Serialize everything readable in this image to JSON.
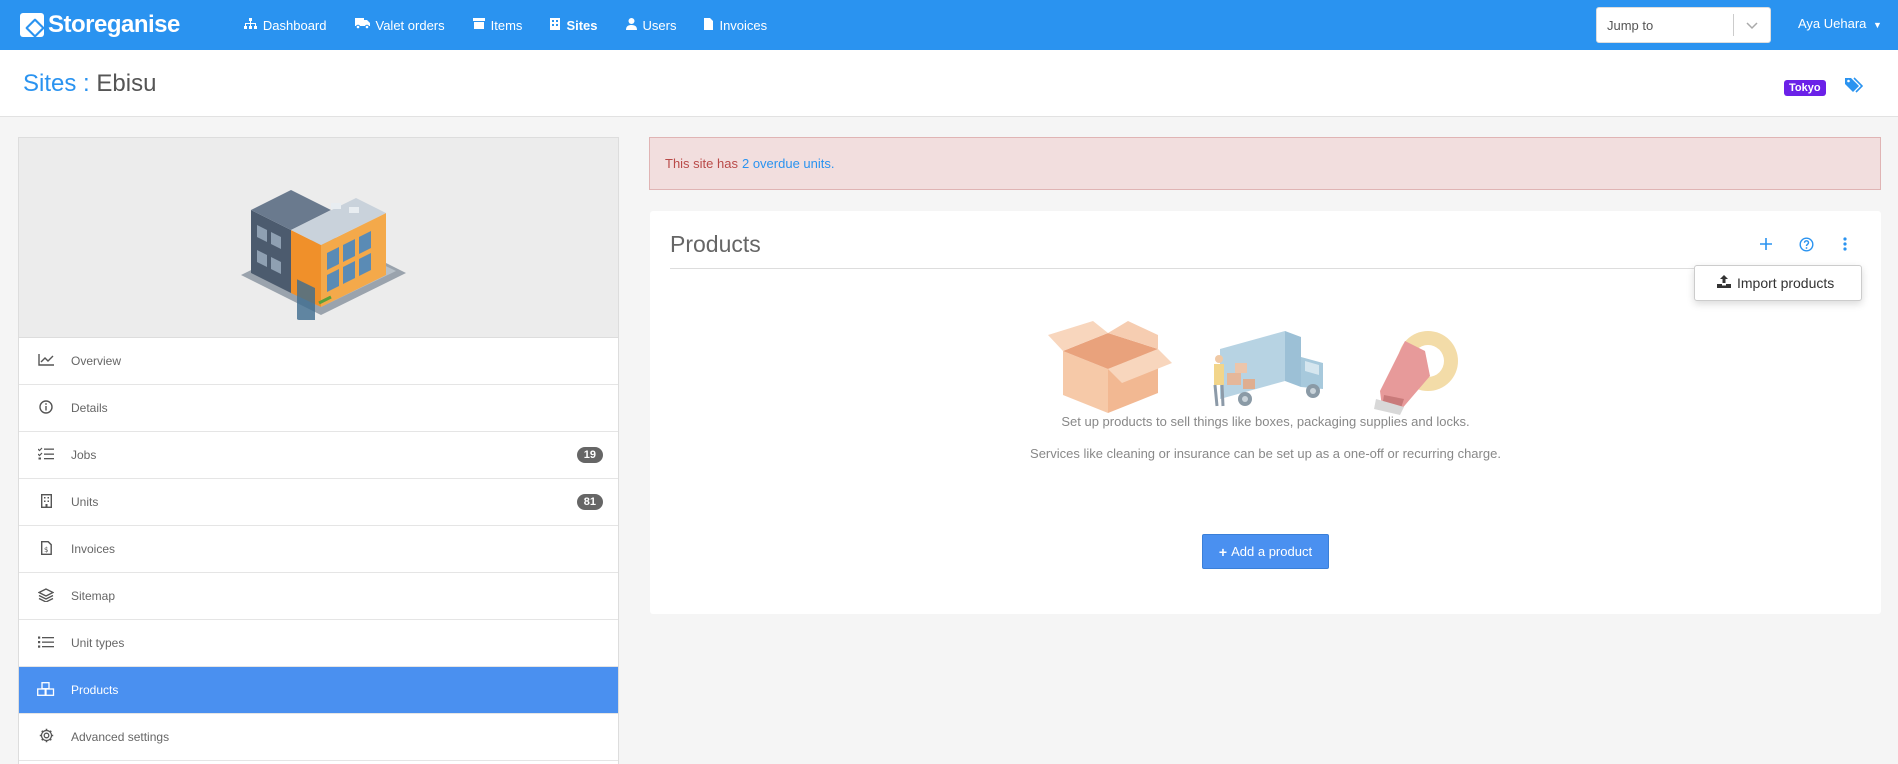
{
  "brand": {
    "name": "Storeganise"
  },
  "nav": {
    "items": [
      {
        "label": "Dashboard",
        "icon": "sitemap-icon"
      },
      {
        "label": "Valet orders",
        "icon": "truck-icon"
      },
      {
        "label": "Items",
        "icon": "archive-icon"
      },
      {
        "label": "Sites",
        "icon": "building-icon"
      },
      {
        "label": "Users",
        "icon": "user-icon"
      },
      {
        "label": "Invoices",
        "icon": "file-icon"
      }
    ],
    "jump_placeholder": "Jump to",
    "user_name": "Aya Uehara"
  },
  "header": {
    "crumb": "Sites",
    "separator": ":",
    "site_name": "Ebisu",
    "tag": "Tokyo"
  },
  "sidebar": {
    "items": [
      {
        "label": "Overview",
        "icon": "chart-line-icon"
      },
      {
        "label": "Details",
        "icon": "info-circle-icon"
      },
      {
        "label": "Jobs",
        "icon": "tasks-icon",
        "badge": "19"
      },
      {
        "label": "Units",
        "icon": "building-icon",
        "badge": "81"
      },
      {
        "label": "Invoices",
        "icon": "invoice-icon"
      },
      {
        "label": "Sitemap",
        "icon": "layers-icon"
      },
      {
        "label": "Unit types",
        "icon": "list-icon"
      },
      {
        "label": "Products",
        "icon": "boxes-icon"
      },
      {
        "label": "Advanced settings",
        "icon": "gear-icon"
      }
    ]
  },
  "alert": {
    "prefix": "This site has",
    "link": "2 overdue units."
  },
  "products": {
    "title": "Products",
    "menu_item": "Import products",
    "line1": "Set up products to sell things like boxes, packaging supplies and locks.",
    "line2": "Services like cleaning or insurance can be set up as a one-off or recurring charge.",
    "add_button": "Add a product"
  },
  "colors": {
    "primary": "#2a93f0",
    "active_item": "#4a90f0",
    "alert_bg": "#f2dede",
    "tag": "#6b21e8"
  }
}
